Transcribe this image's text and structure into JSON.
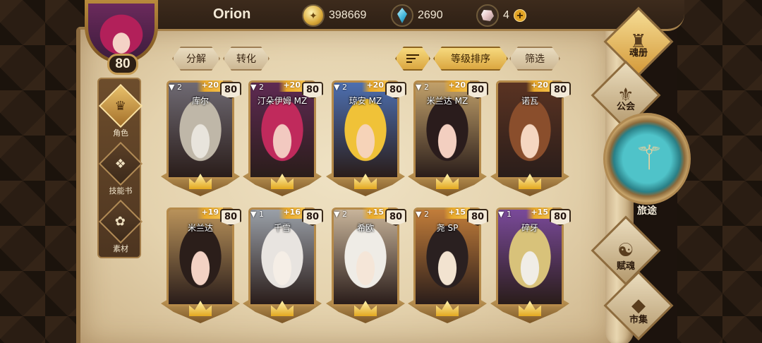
{
  "player": {
    "name": "Orion",
    "level": "80"
  },
  "resources": {
    "gold": "398669",
    "gems": "2690",
    "stones": "4"
  },
  "left_nav": [
    {
      "label": "角色",
      "icon": "helmet-icon",
      "glyph": "♛",
      "active": true
    },
    {
      "label": "技能书",
      "icon": "skill-book-icon",
      "glyph": "❖",
      "active": false
    },
    {
      "label": "素材",
      "icon": "material-icon",
      "glyph": "✿",
      "active": false
    }
  ],
  "filters": {
    "decompose": "分解",
    "transform": "转化",
    "sort_by_level": "等级排序",
    "filter": "筛选"
  },
  "cards": [
    {
      "name": "库尔",
      "stars": "2",
      "plus": "+20",
      "level": "80",
      "palette": [
        "#e8e4dc",
        "#bfb7a8",
        "#6f6a73"
      ]
    },
    {
      "name": "汀朵伊姆 MZ",
      "stars": "2",
      "plus": "+20",
      "level": "80",
      "palette": [
        "#f2c9c0",
        "#c02a5c",
        "#5e2a52"
      ]
    },
    {
      "name": "琼安 MZ",
      "stars": "2",
      "plus": "+20",
      "level": "80",
      "palette": [
        "#f6d3b8",
        "#f0c238",
        "#4d6fb0"
      ]
    },
    {
      "name": "米兰达 MZ",
      "stars": "2",
      "plus": "+20",
      "level": "80",
      "palette": [
        "#f3cfc0",
        "#2a1c1c",
        "#c1a06a"
      ]
    },
    {
      "name": "诺瓦",
      "stars": "",
      "plus": "+20",
      "level": "80",
      "palette": [
        "#f5d6c0",
        "#8a4e2c",
        "#5a3322"
      ]
    },
    {
      "name": "米兰达",
      "stars": "",
      "plus": "+19",
      "level": "80",
      "palette": [
        "#f3d2c4",
        "#2b1e1a",
        "#b9925a"
      ]
    },
    {
      "name": "千雪",
      "stars": "1",
      "plus": "+16",
      "level": "80",
      "palette": [
        "#f5eee6",
        "#e8e4e0",
        "#9aa0a8"
      ]
    },
    {
      "name": "希欧",
      "stars": "2",
      "plus": "+15",
      "level": "80",
      "palette": [
        "#f5e6d8",
        "#efece6",
        "#c8b49a"
      ]
    },
    {
      "name": "尧 SP",
      "stars": "2",
      "plus": "+15",
      "level": "80",
      "palette": [
        "#f2e3d0",
        "#2a2020",
        "#c27d3a"
      ]
    },
    {
      "name": "碎牙",
      "stars": "1",
      "plus": "+15",
      "level": "80",
      "palette": [
        "#f0ede6",
        "#d8c27a",
        "#7a4a9a"
      ]
    }
  ],
  "right_menu": {
    "soul_book": "魂册",
    "guild": "公会",
    "journey": "旅途",
    "fusion": "赋魂",
    "market": "市集"
  },
  "colors": {
    "gold": "#dba740",
    "parchment": "#e6d4b0",
    "frame": "#8b6a3f"
  }
}
